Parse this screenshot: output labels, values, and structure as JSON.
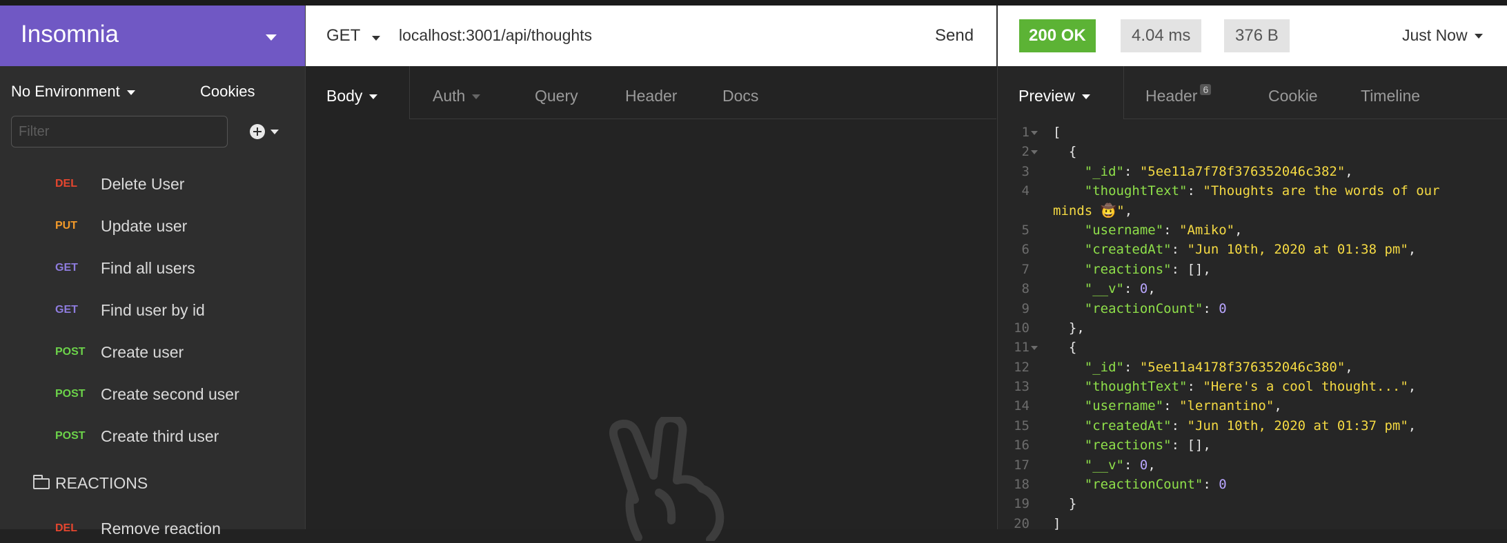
{
  "sidebar": {
    "app_name": "Insomnia",
    "environment": "No Environment",
    "cookies": "Cookies",
    "filter_placeholder": "Filter",
    "requests": [
      {
        "method": "DEL",
        "name": "Delete User"
      },
      {
        "method": "PUT",
        "name": "Update user"
      },
      {
        "method": "GET",
        "name": "Find all users"
      },
      {
        "method": "GET",
        "name": "Find user by id"
      },
      {
        "method": "POST",
        "name": "Create user"
      },
      {
        "method": "POST",
        "name": "Create second user"
      },
      {
        "method": "POST",
        "name": "Create third user"
      }
    ],
    "folder": "REACTIONS",
    "folder_request": {
      "method": "DEL",
      "name": "Remove reaction"
    }
  },
  "request": {
    "method": "GET",
    "url": "localhost:3001/api/thoughts",
    "send": "Send",
    "tabs": [
      "Body",
      "Auth",
      "Query",
      "Header",
      "Docs"
    ]
  },
  "response": {
    "status": "200 OK",
    "time": "4.04 ms",
    "size": "376 B",
    "when": "Just Now",
    "tabs": [
      "Preview",
      "Header",
      "Cookie",
      "Timeline"
    ],
    "header_count": "6",
    "lines": [
      {
        "n": "1",
        "fold": true,
        "parts": [
          [
            "p",
            "["
          ]
        ]
      },
      {
        "n": "2",
        "fold": true,
        "parts": [
          [
            "p",
            "  {"
          ]
        ]
      },
      {
        "n": "3",
        "parts": [
          [
            "p",
            "    "
          ],
          [
            "k",
            "\"_id\""
          ],
          [
            "p",
            ": "
          ],
          [
            "s",
            "\"5ee11a7f78f376352046c382\""
          ],
          [
            "p",
            ","
          ]
        ]
      },
      {
        "n": "4",
        "parts": [
          [
            "p",
            "    "
          ],
          [
            "k",
            "\"thoughtText\""
          ],
          [
            "p",
            ": "
          ],
          [
            "s",
            "\"Thoughts are the words of our"
          ]
        ]
      },
      {
        "n": "",
        "wrap": true,
        "parts": [
          [
            "s",
            "minds 🤠\""
          ],
          [
            "p",
            ","
          ]
        ]
      },
      {
        "n": "5",
        "parts": [
          [
            "p",
            "    "
          ],
          [
            "k",
            "\"username\""
          ],
          [
            "p",
            ": "
          ],
          [
            "s",
            "\"Amiko\""
          ],
          [
            "p",
            ","
          ]
        ]
      },
      {
        "n": "6",
        "parts": [
          [
            "p",
            "    "
          ],
          [
            "k",
            "\"createdAt\""
          ],
          [
            "p",
            ": "
          ],
          [
            "s",
            "\"Jun 10th, 2020 at 01:38 pm\""
          ],
          [
            "p",
            ","
          ]
        ]
      },
      {
        "n": "7",
        "parts": [
          [
            "p",
            "    "
          ],
          [
            "k",
            "\"reactions\""
          ],
          [
            "p",
            ": [],"
          ]
        ]
      },
      {
        "n": "8",
        "parts": [
          [
            "p",
            "    "
          ],
          [
            "k",
            "\"__v\""
          ],
          [
            "p",
            ": "
          ],
          [
            "n",
            "0"
          ],
          [
            "p",
            ","
          ]
        ]
      },
      {
        "n": "9",
        "parts": [
          [
            "p",
            "    "
          ],
          [
            "k",
            "\"reactionCount\""
          ],
          [
            "p",
            ": "
          ],
          [
            "n",
            "0"
          ]
        ]
      },
      {
        "n": "10",
        "parts": [
          [
            "p",
            "  },"
          ]
        ]
      },
      {
        "n": "11",
        "fold": true,
        "parts": [
          [
            "p",
            "  {"
          ]
        ]
      },
      {
        "n": "12",
        "parts": [
          [
            "p",
            "    "
          ],
          [
            "k",
            "\"_id\""
          ],
          [
            "p",
            ": "
          ],
          [
            "s",
            "\"5ee11a4178f376352046c380\""
          ],
          [
            "p",
            ","
          ]
        ]
      },
      {
        "n": "13",
        "parts": [
          [
            "p",
            "    "
          ],
          [
            "k",
            "\"thoughtText\""
          ],
          [
            "p",
            ": "
          ],
          [
            "s",
            "\"Here's a cool thought...\""
          ],
          [
            "p",
            ","
          ]
        ]
      },
      {
        "n": "14",
        "parts": [
          [
            "p",
            "    "
          ],
          [
            "k",
            "\"username\""
          ],
          [
            "p",
            ": "
          ],
          [
            "s",
            "\"lernantino\""
          ],
          [
            "p",
            ","
          ]
        ]
      },
      {
        "n": "15",
        "parts": [
          [
            "p",
            "    "
          ],
          [
            "k",
            "\"createdAt\""
          ],
          [
            "p",
            ": "
          ],
          [
            "s",
            "\"Jun 10th, 2020 at 01:37 pm\""
          ],
          [
            "p",
            ","
          ]
        ]
      },
      {
        "n": "16",
        "parts": [
          [
            "p",
            "    "
          ],
          [
            "k",
            "\"reactions\""
          ],
          [
            "p",
            ": [],"
          ]
        ]
      },
      {
        "n": "17",
        "parts": [
          [
            "p",
            "    "
          ],
          [
            "k",
            "\"__v\""
          ],
          [
            "p",
            ": "
          ],
          [
            "n",
            "0"
          ],
          [
            "p",
            ","
          ]
        ]
      },
      {
        "n": "18",
        "parts": [
          [
            "p",
            "    "
          ],
          [
            "k",
            "\"reactionCount\""
          ],
          [
            "p",
            ": "
          ],
          [
            "n",
            "0"
          ]
        ]
      },
      {
        "n": "19",
        "parts": [
          [
            "p",
            "  }"
          ]
        ]
      },
      {
        "n": "20",
        "parts": [
          [
            "p",
            "]"
          ]
        ]
      }
    ]
  },
  "colors": {
    "brand": "#7058c4",
    "status_ok": "#5cb335",
    "method_del": "#e5462f",
    "method_put": "#f29a2a",
    "method_get": "#8e7cde",
    "method_post": "#6cd34a",
    "json_key": "#8fe04a",
    "json_string": "#f5da43",
    "json_number": "#b9a6ff"
  },
  "icons": {
    "env_caret": "chevron-down-icon",
    "add": "plus-circle-icon",
    "folder": "folder-icon",
    "empty_state": "peace-hand-icon"
  }
}
